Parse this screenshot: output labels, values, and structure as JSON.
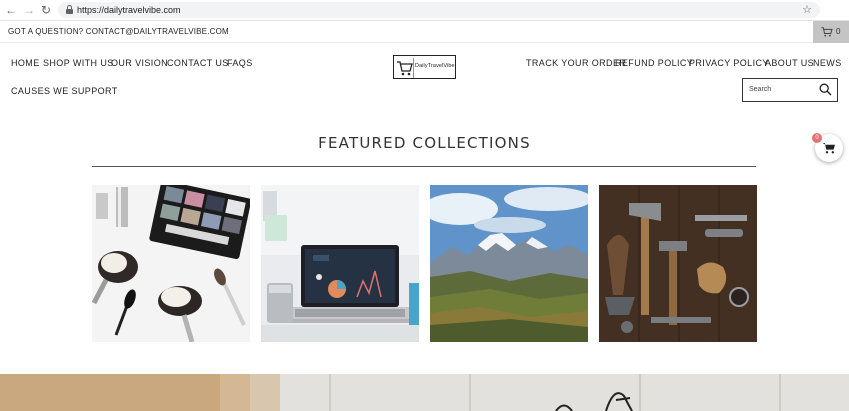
{
  "browser": {
    "url": "https://dailytravelvibe.com",
    "back_icon": "arrow-left-icon",
    "forward_icon": "arrow-right-icon",
    "reload_icon": "reload-icon",
    "bookmark_icon": "star-icon"
  },
  "announcement": {
    "text": "GOT A QUESTION? CONTACT@DAILYTRAVELVIBE.COM",
    "cart_count": "0"
  },
  "nav_left": [
    "HOME",
    "SHOP WITH US",
    "OUR VISION",
    "CONTACT US",
    "FAQS"
  ],
  "nav_left_row2": [
    "CAUSES WE SUPPORT"
  ],
  "nav_right": [
    "TRACK YOUR ORDER",
    "REFUND POLICY",
    "PRIVACY POLICY",
    "ABOUT US",
    "NEWS"
  ],
  "logo": {
    "text": "DailyTravelVibe"
  },
  "search": {
    "placeholder": "Search"
  },
  "featured": {
    "title": "FEATURED COLLECTIONS",
    "collections": [
      {
        "image": "makeup-brushes-palette"
      },
      {
        "image": "laptop-analytics"
      },
      {
        "image": "mountain-landscape"
      },
      {
        "image": "vintage-tools"
      }
    ]
  },
  "floating_cart": {
    "count": "0"
  },
  "colors": {
    "badge": "#e57373",
    "cart_bar": "#c4c4c4",
    "text": "#222222"
  }
}
